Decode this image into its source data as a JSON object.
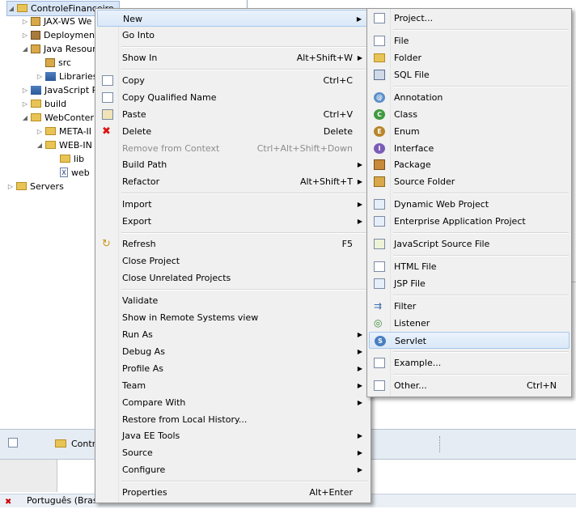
{
  "tree": {
    "items": [
      {
        "label": "ControleFinanceiro"
      },
      {
        "label": "JAX-WS We"
      },
      {
        "label": "Deploymen"
      },
      {
        "label": "Java Resour"
      },
      {
        "label": "src"
      },
      {
        "label": "Libraries"
      },
      {
        "label": "JavaScript R"
      },
      {
        "label": "build"
      },
      {
        "label": "WebConter"
      },
      {
        "label": "META-II"
      },
      {
        "label": "WEB-IN"
      },
      {
        "label": "lib"
      },
      {
        "label": "web"
      },
      {
        "label": "Servers"
      }
    ]
  },
  "lower": {
    "tab_label": "Contr",
    "status_text": "Português (Brasil"
  },
  "context_menu": {
    "items": [
      {
        "label": "New",
        "shortcut": "",
        "submenu": true
      },
      {
        "label": "Go Into",
        "shortcut": ""
      },
      {
        "label": "Show In",
        "shortcut": "Alt+Shift+W",
        "submenu": true
      },
      {
        "label": "Copy",
        "shortcut": "Ctrl+C"
      },
      {
        "label": "Copy Qualified Name",
        "shortcut": ""
      },
      {
        "label": "Paste",
        "shortcut": "Ctrl+V"
      },
      {
        "label": "Delete",
        "shortcut": "Delete"
      },
      {
        "label": "Remove from Context",
        "shortcut": "Ctrl+Alt+Shift+Down",
        "disabled": true
      },
      {
        "label": "Build Path",
        "shortcut": "",
        "submenu": true
      },
      {
        "label": "Refactor",
        "shortcut": "Alt+Shift+T",
        "submenu": true
      },
      {
        "label": "Import",
        "shortcut": "",
        "submenu": true
      },
      {
        "label": "Export",
        "shortcut": "",
        "submenu": true
      },
      {
        "label": "Refresh",
        "shortcut": "F5"
      },
      {
        "label": "Close Project",
        "shortcut": ""
      },
      {
        "label": "Close Unrelated Projects",
        "shortcut": ""
      },
      {
        "label": "Validate",
        "shortcut": ""
      },
      {
        "label": "Show in Remote Systems view",
        "shortcut": ""
      },
      {
        "label": "Run As",
        "shortcut": "",
        "submenu": true
      },
      {
        "label": "Debug As",
        "shortcut": "",
        "submenu": true
      },
      {
        "label": "Profile As",
        "shortcut": "",
        "submenu": true
      },
      {
        "label": "Team",
        "shortcut": "",
        "submenu": true
      },
      {
        "label": "Compare With",
        "shortcut": "",
        "submenu": true
      },
      {
        "label": "Restore from Local History...",
        "shortcut": ""
      },
      {
        "label": "Java EE Tools",
        "shortcut": "",
        "submenu": true
      },
      {
        "label": "Source",
        "shortcut": "",
        "submenu": true
      },
      {
        "label": "Configure",
        "shortcut": "",
        "submenu": true
      },
      {
        "label": "Properties",
        "shortcut": "Alt+Enter"
      }
    ]
  },
  "submenu": {
    "items": [
      {
        "label": "Project..."
      },
      {
        "label": "File"
      },
      {
        "label": "Folder"
      },
      {
        "label": "SQL File"
      },
      {
        "label": "Annotation"
      },
      {
        "label": "Class"
      },
      {
        "label": "Enum"
      },
      {
        "label": "Interface"
      },
      {
        "label": "Package"
      },
      {
        "label": "Source Folder"
      },
      {
        "label": "Dynamic Web Project"
      },
      {
        "label": "Enterprise Application Project"
      },
      {
        "label": "JavaScript Source File"
      },
      {
        "label": "HTML File"
      },
      {
        "label": "JSP File"
      },
      {
        "label": "Filter"
      },
      {
        "label": "Listener"
      },
      {
        "label": "Servlet"
      },
      {
        "label": "Example..."
      },
      {
        "label": "Other...",
        "shortcut": "Ctrl+N"
      }
    ]
  },
  "colors": {
    "highlight": "#dae8f8",
    "menu_bg": "#f0f0f0",
    "arrow": "#000000"
  },
  "glyphs": {
    "submenu_arrow": "▶",
    "tree_expanded": "◢",
    "tree_collapsed": "▷",
    "delete_mark": "✖"
  }
}
